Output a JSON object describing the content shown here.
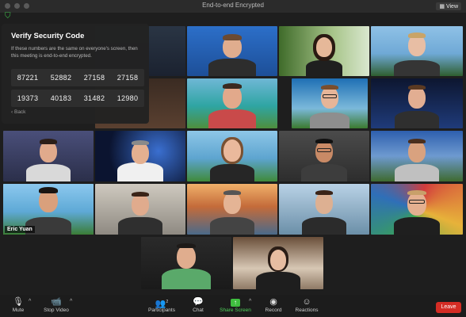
{
  "window": {
    "title": "End-to-end Encrypted",
    "view_label": "View"
  },
  "participants_grid": [
    {
      "id": "p01",
      "name": ""
    },
    {
      "id": "p02",
      "name": ""
    },
    {
      "id": "p03",
      "name": ""
    },
    {
      "id": "p04",
      "name": ""
    },
    {
      "id": "p05",
      "name": ""
    },
    {
      "id": "p06",
      "name": ""
    },
    {
      "id": "p07",
      "name": ""
    },
    {
      "id": "p08",
      "name": ""
    },
    {
      "id": "p09",
      "name": ""
    },
    {
      "id": "p10",
      "name": ""
    },
    {
      "id": "p11",
      "name": ""
    },
    {
      "id": "p12",
      "name": ""
    },
    {
      "id": "p13",
      "name": ""
    },
    {
      "id": "p14",
      "name": ""
    },
    {
      "id": "p15",
      "name": "Eric Yuan"
    },
    {
      "id": "p16",
      "name": ""
    },
    {
      "id": "p17",
      "name": ""
    },
    {
      "id": "p18",
      "name": ""
    },
    {
      "id": "p19",
      "name": ""
    },
    {
      "id": "p20",
      "name": ""
    },
    {
      "id": "p21",
      "name": ""
    },
    {
      "id": "p22",
      "name": ""
    }
  ],
  "security_panel": {
    "title": "Verify Security Code",
    "description": "If these numbers are the same on everyone's screen, then this meeting is end-to-end encrypted.",
    "codes_row1": [
      "87221",
      "52882",
      "27158",
      "27158"
    ],
    "codes_row2": [
      "19373",
      "40183",
      "31482",
      "12980"
    ],
    "back_label": "Back"
  },
  "toolbar": {
    "mute": "Mute",
    "stop_video": "Stop Video",
    "participants": "Participants",
    "participants_count": "2",
    "chat": "Chat",
    "share_screen": "Share Screen",
    "record": "Record",
    "reactions": "Reactions",
    "leave": "Leave"
  },
  "colors": {
    "active_speaker": "#c9e06a",
    "leave": "#d42c24",
    "share": "#3fbf3f",
    "shield": "#3fc24a"
  },
  "icons": [
    "shield-icon",
    "mic-icon",
    "video-icon",
    "participants-icon",
    "chat-icon",
    "share-screen-icon",
    "record-icon",
    "reactions-icon"
  ]
}
